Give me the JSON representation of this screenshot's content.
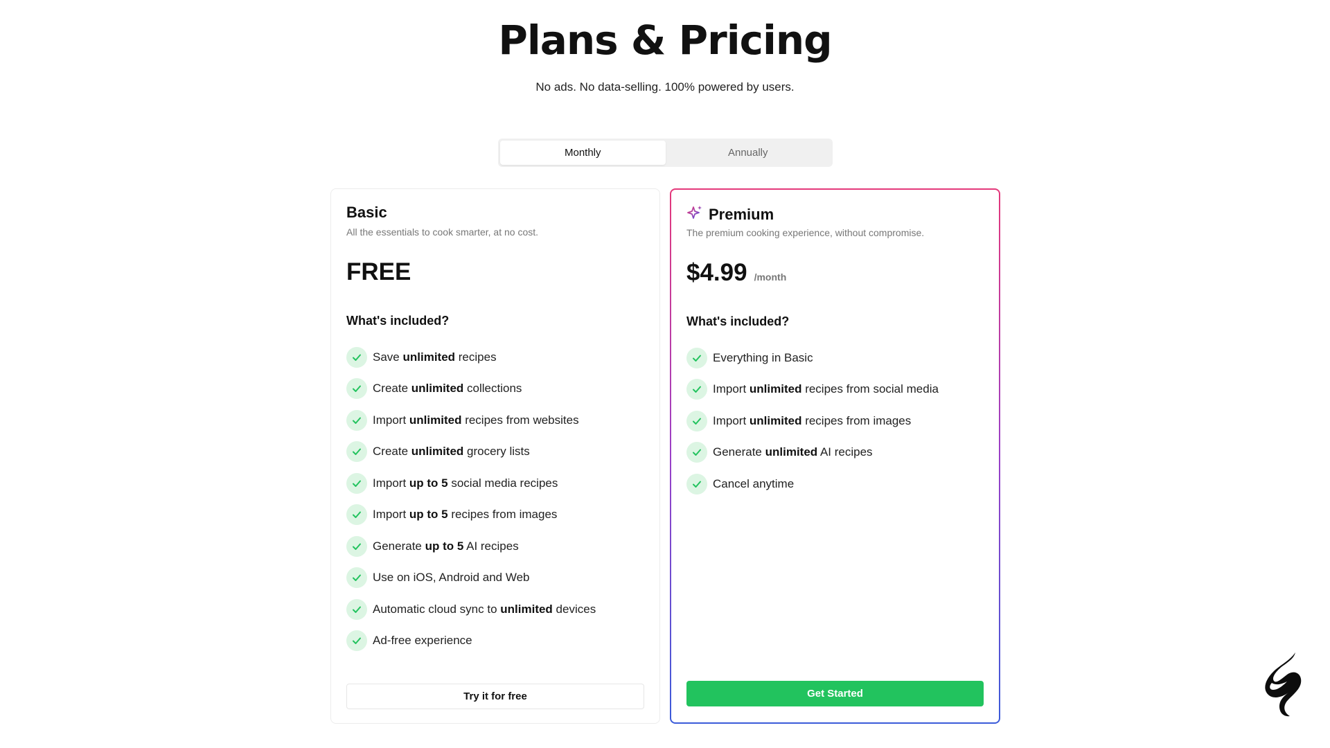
{
  "header": {
    "title": "Plans & Pricing",
    "subtitle": "No ads. No data-selling. 100% powered by users."
  },
  "billing_toggle": {
    "options": [
      "Monthly",
      "Annually"
    ],
    "selected": "Monthly"
  },
  "plans": {
    "basic": {
      "name": "Basic",
      "description": "All the essentials to cook smarter, at no cost.",
      "price": "FREE",
      "included_heading": "What's included?",
      "features": [
        {
          "pre": "Save ",
          "bold": "unlimited",
          "post": " recipes"
        },
        {
          "pre": "Create ",
          "bold": "unlimited",
          "post": " collections"
        },
        {
          "pre": "Import ",
          "bold": "unlimited",
          "post": " recipes from websites"
        },
        {
          "pre": "Create ",
          "bold": "unlimited",
          "post": " grocery lists"
        },
        {
          "pre": "Import ",
          "bold": "up to 5",
          "post": " social media recipes"
        },
        {
          "pre": "Import ",
          "bold": "up to 5",
          "post": " recipes from images"
        },
        {
          "pre": "Generate ",
          "bold": "up to 5",
          "post": " AI recipes"
        },
        {
          "pre": "Use on iOS, Android and Web",
          "bold": "",
          "post": ""
        },
        {
          "pre": "Automatic cloud sync to ",
          "bold": "unlimited",
          "post": " devices"
        },
        {
          "pre": "Ad-free experience",
          "bold": "",
          "post": ""
        }
      ],
      "cta": "Try it for free"
    },
    "premium": {
      "name": "Premium",
      "description": "The premium cooking experience, without compromise.",
      "price": "$4.99",
      "price_period": "/month",
      "included_heading": "What's included?",
      "features": [
        {
          "pre": "Everything in Basic",
          "bold": "",
          "post": ""
        },
        {
          "pre": "Import ",
          "bold": "unlimited",
          "post": " recipes from social media"
        },
        {
          "pre": "Import ",
          "bold": "unlimited",
          "post": " recipes from images"
        },
        {
          "pre": "Generate ",
          "bold": "unlimited",
          "post": " AI recipes"
        },
        {
          "pre": "Cancel anytime",
          "bold": "",
          "post": ""
        }
      ],
      "cta": "Get Started"
    }
  },
  "colors": {
    "accent_green": "#22c35e",
    "check_bg": "#dcf5e3",
    "premium_gradient_top": "#e4387a",
    "premium_gradient_bottom": "#3a5bd9"
  },
  "icons": {
    "premium": "sparkle-icon",
    "feature": "check-icon",
    "brand": "flame-logo-icon"
  }
}
